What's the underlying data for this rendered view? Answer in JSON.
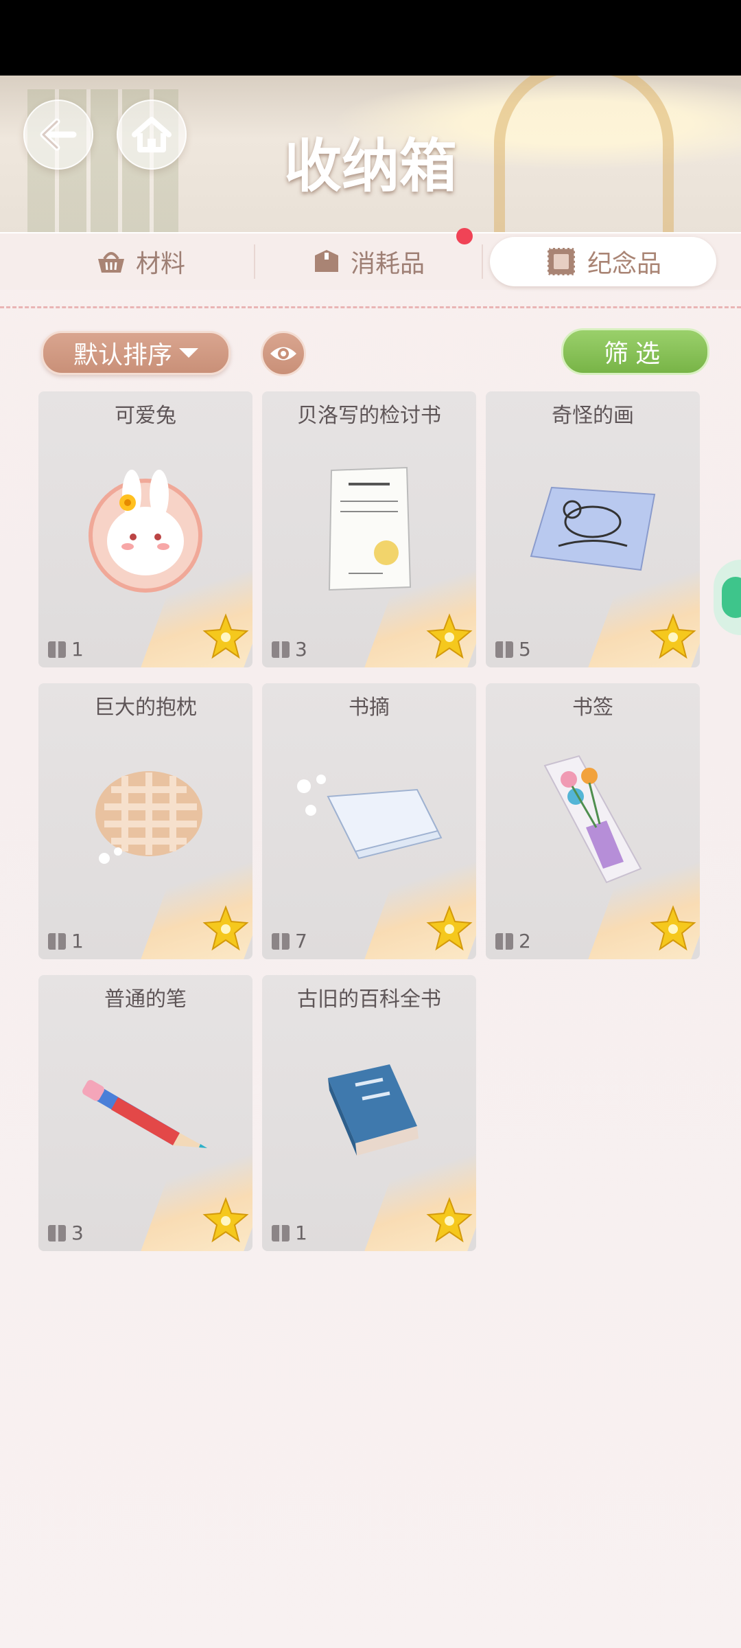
{
  "header": {
    "title": "收纳箱"
  },
  "tabs": [
    {
      "label": "材料",
      "icon": "basket-icon",
      "active": false
    },
    {
      "label": "消耗品",
      "icon": "box-icon",
      "active": false,
      "badge": true
    },
    {
      "label": "纪念品",
      "icon": "stamp-icon",
      "active": true
    }
  ],
  "toolbar": {
    "sort_label": "默认排序",
    "filter_label": "筛选"
  },
  "items": [
    {
      "name": "可爱兔",
      "count": "1"
    },
    {
      "name": "贝洛写的检讨书",
      "count": "3"
    },
    {
      "name": "奇怪的画",
      "count": "5"
    },
    {
      "name": "巨大的抱枕",
      "count": "1"
    },
    {
      "name": "书摘",
      "count": "7"
    },
    {
      "name": "书签",
      "count": "2"
    },
    {
      "name": "普通的笔",
      "count": "3"
    },
    {
      "name": "古旧的百科全书",
      "count": "1"
    }
  ],
  "colors": {
    "accent_brown": "#c99078",
    "filter_green": "#78b447",
    "badge_red": "#f04356"
  }
}
